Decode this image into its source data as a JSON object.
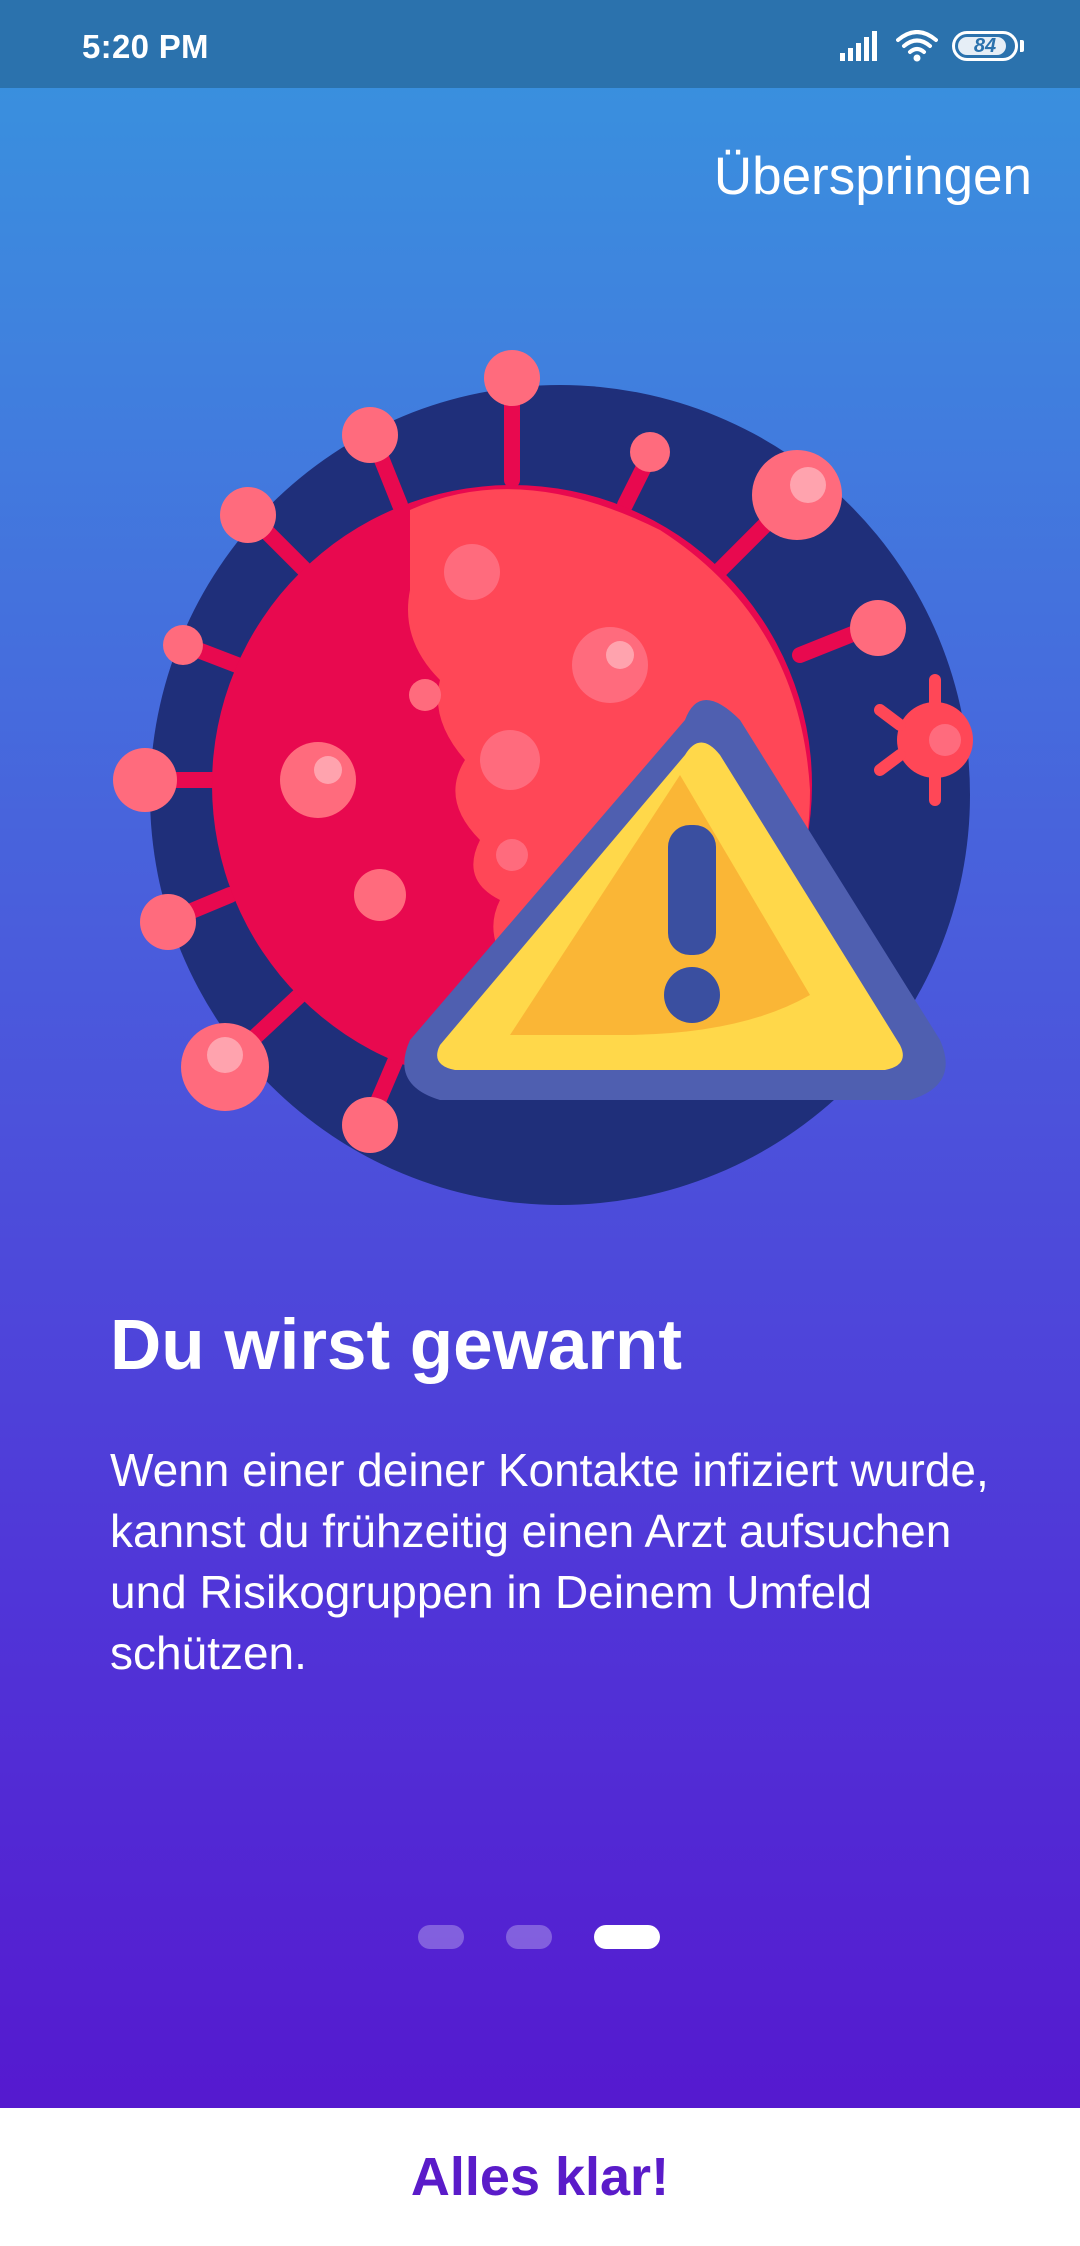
{
  "status_bar": {
    "time": "5:20 PM",
    "battery_level": "84",
    "icons": [
      "signal-icon",
      "wifi-icon",
      "battery-icon"
    ]
  },
  "onboarding": {
    "skip_label": "Überspringen",
    "title": "Du wirst gewarnt",
    "description": "Wenn einer deiner Kontakte infiziert wurde, kannst du frühzeitig einen Arzt aufsuchen und Risikogruppen in Deinem Umfeld schützen.",
    "page_count": 3,
    "current_page": 3,
    "illustration_icon": "virus-warning-icon"
  },
  "footer": {
    "confirm_label": "Alles klar!"
  },
  "colors": {
    "status_bar": "#2b72ad",
    "gradient_top": "#3794de",
    "gradient_bottom": "#5519cf",
    "accent_text": "#5a1bc9",
    "virus_red": "#e8094f",
    "virus_light": "#ff4757",
    "warning_yellow": "#ffd84a"
  }
}
